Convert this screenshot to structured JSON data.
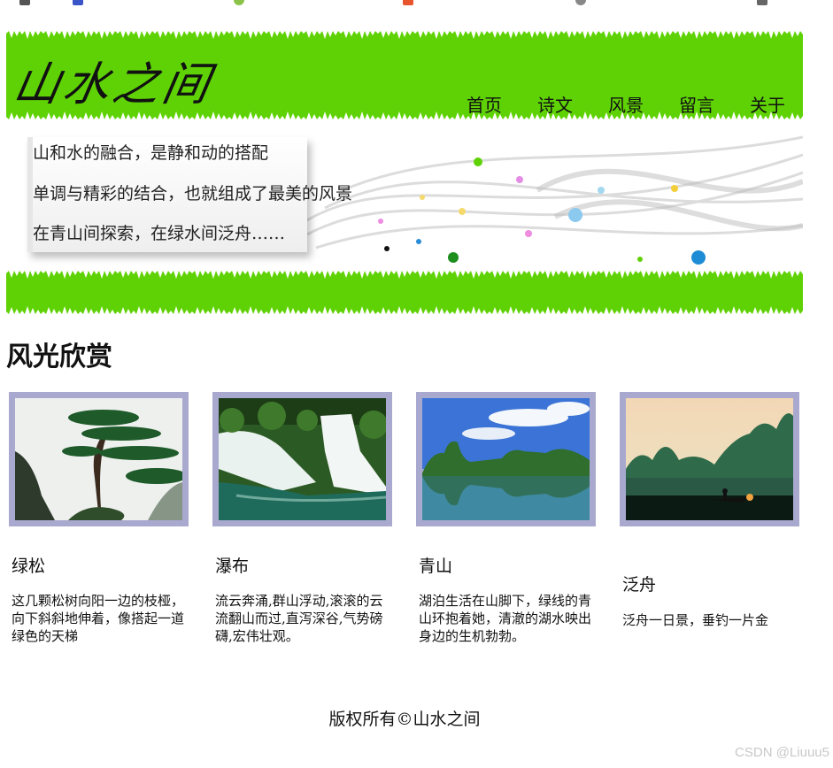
{
  "header": {
    "site_title": "山水之间",
    "nav": [
      "首页",
      "诗文",
      "风景",
      "留言",
      "关于"
    ]
  },
  "banner": {
    "lines": [
      "山和水的融合，是静和动的搭配",
      "单调与精彩的结合，也就组成了最美的风景",
      "在青山间探索，在绿水间泛舟……"
    ]
  },
  "section": {
    "title": "风光欣赏"
  },
  "cards": [
    {
      "title": "绿松",
      "desc": "这几颗松树向阳一边的枝桠，向下斜斜地伸着，像搭起一道绿色的天梯"
    },
    {
      "title": "瀑布",
      "desc": "流云奔涌,群山浮动,滚滚的云流翻山而过,直泻深谷,气势磅礴,宏伟壮观。"
    },
    {
      "title": "青山",
      "desc": "湖泊生活在山脚下，绿线的青山环抱着她，清澈的湖水映出身边的生机勃勃。"
    },
    {
      "title": "泛舟",
      "desc": "泛舟一日景，垂钓一片金"
    }
  ],
  "footer": {
    "text": "版权所有©山水之间"
  },
  "watermark": "CSDN @Liuuu5",
  "colors": {
    "grass_green": "#5fd205",
    "thumb_border": "#a9a9d0"
  }
}
